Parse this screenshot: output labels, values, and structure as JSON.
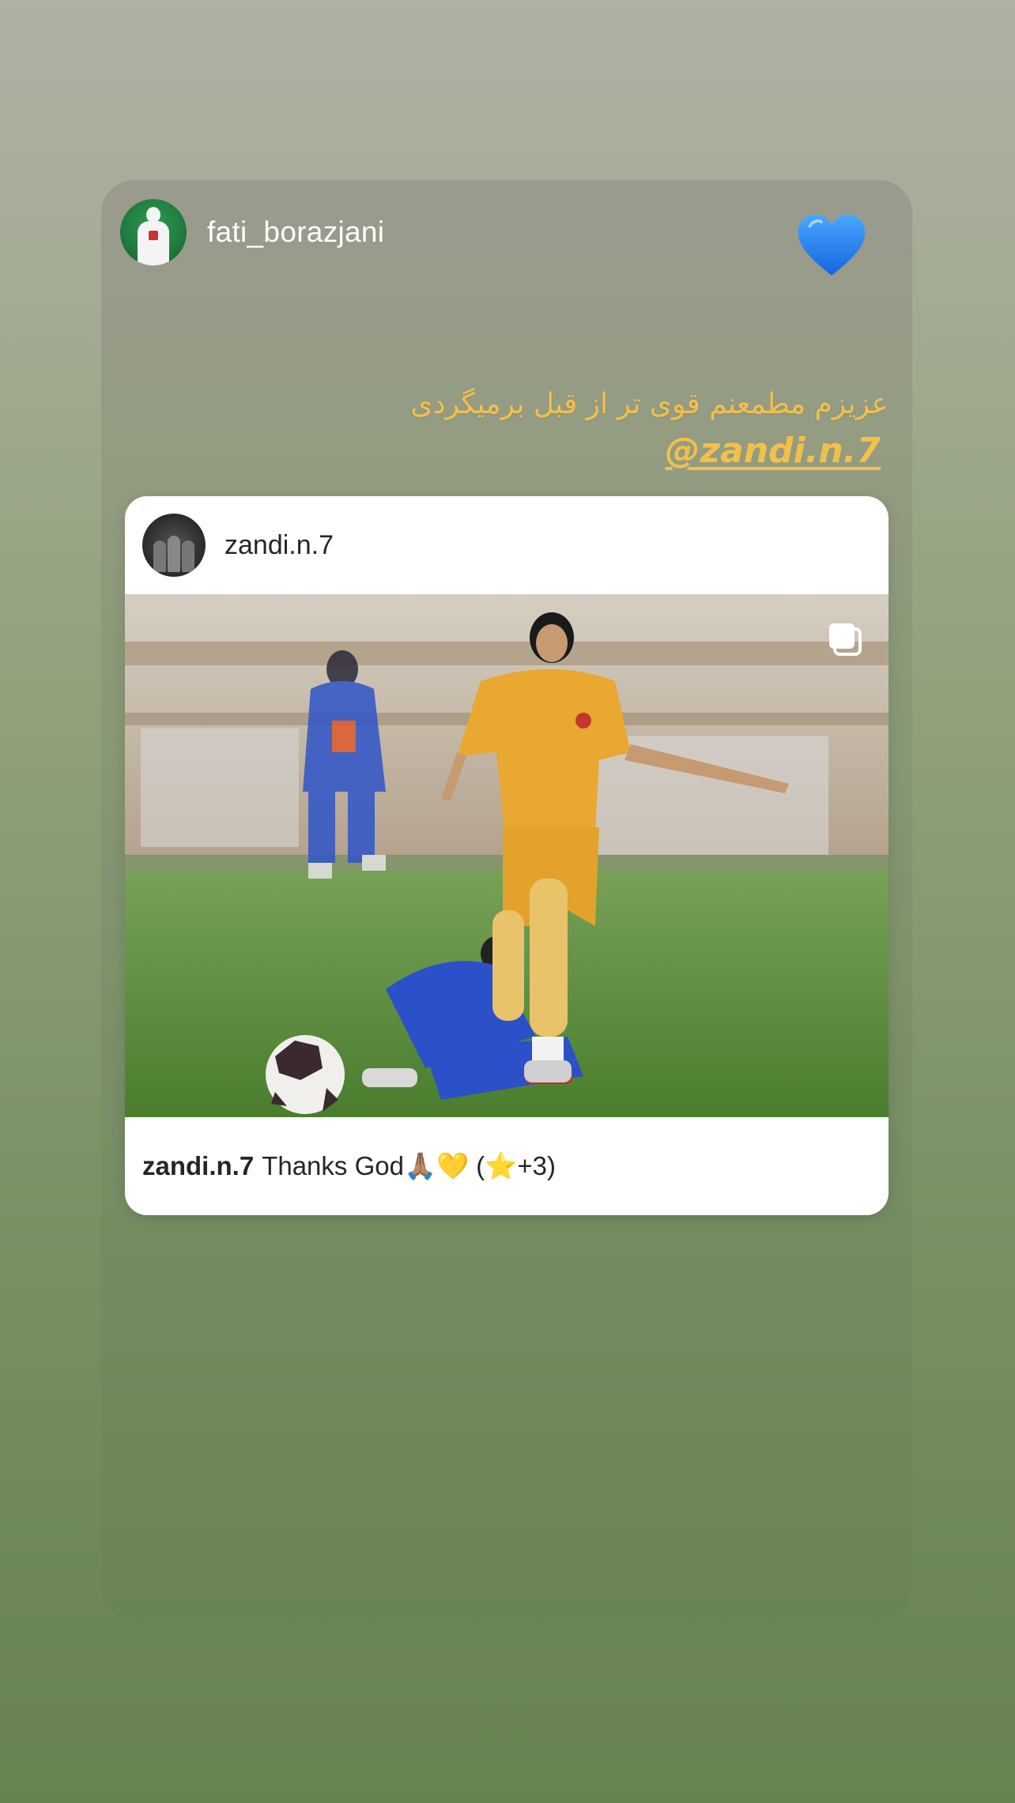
{
  "story": {
    "author_username": "fati_borazjani",
    "sticker_icon": "blue-heart-icon",
    "caption_text": "عزیزم مطمعنم قوی تر از قبل برمیگردی",
    "mention": "@zandi.n.7",
    "accent_color": "#f3c04a"
  },
  "shared_post": {
    "username": "zandi.n.7",
    "media_icon": "multiple-photos-icon",
    "caption_username": "zandi.n.7",
    "caption_text": "Thanks God🙏🏽💛 (⭐️+3)"
  }
}
